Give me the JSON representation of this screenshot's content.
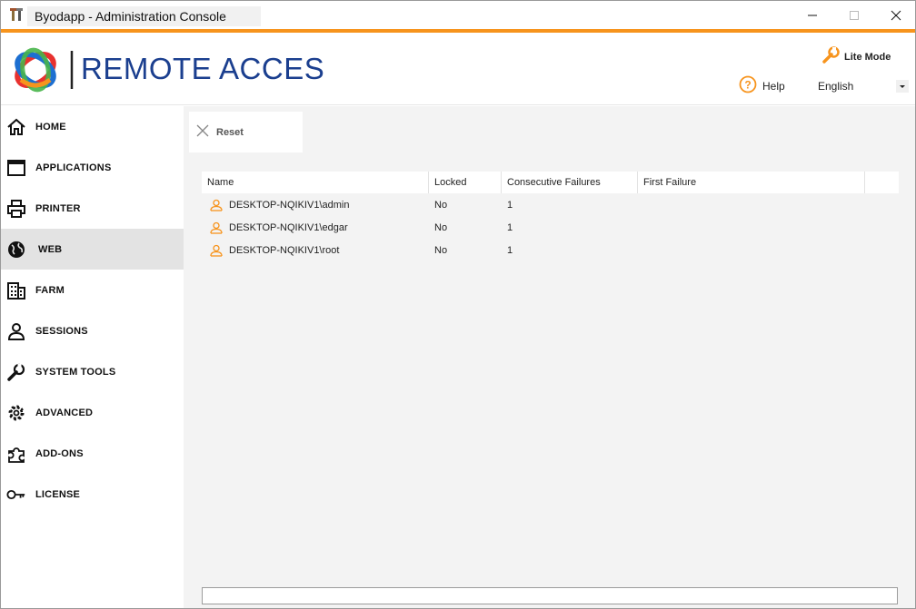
{
  "window": {
    "title": "Byodapp - Administration Console"
  },
  "header": {
    "logo_text": "REMOTE ACCES",
    "lite_mode_label": "Lite Mode",
    "help_label": "Help",
    "language": "English"
  },
  "sidebar": {
    "items": [
      {
        "label": "HOME",
        "icon": "home-icon"
      },
      {
        "label": "APPLICATIONS",
        "icon": "window-icon"
      },
      {
        "label": "PRINTER",
        "icon": "printer-icon"
      },
      {
        "label": "WEB",
        "icon": "globe-icon",
        "active": true
      },
      {
        "label": "FARM",
        "icon": "building-icon"
      },
      {
        "label": "SESSIONS",
        "icon": "user-icon"
      },
      {
        "label": "SYSTEM TOOLS",
        "icon": "wrench-icon"
      },
      {
        "label": "ADVANCED",
        "icon": "gear-icon"
      },
      {
        "label": "ADD-ONS",
        "icon": "puzzle-icon"
      },
      {
        "label": "LICENSE",
        "icon": "key-icon"
      }
    ]
  },
  "toolbar": {
    "reset_label": "Reset"
  },
  "table": {
    "columns": [
      "Name",
      "Locked",
      "Consecutive Failures",
      "First Failure"
    ],
    "rows": [
      {
        "name": "DESKTOP-NQIKIV1\\admin",
        "locked": "No",
        "failures": "1",
        "first_failure": ""
      },
      {
        "name": "DESKTOP-NQIKIV1\\edgar",
        "locked": "No",
        "failures": "1",
        "first_failure": ""
      },
      {
        "name": "DESKTOP-NQIKIV1\\root",
        "locked": "No",
        "failures": "1",
        "first_failure": ""
      }
    ]
  },
  "colors": {
    "accent": "#f7941d",
    "logo_blue": "#1b3f8f",
    "active_nav": "#e3e3e3",
    "content_bg": "#f3f3f3"
  }
}
